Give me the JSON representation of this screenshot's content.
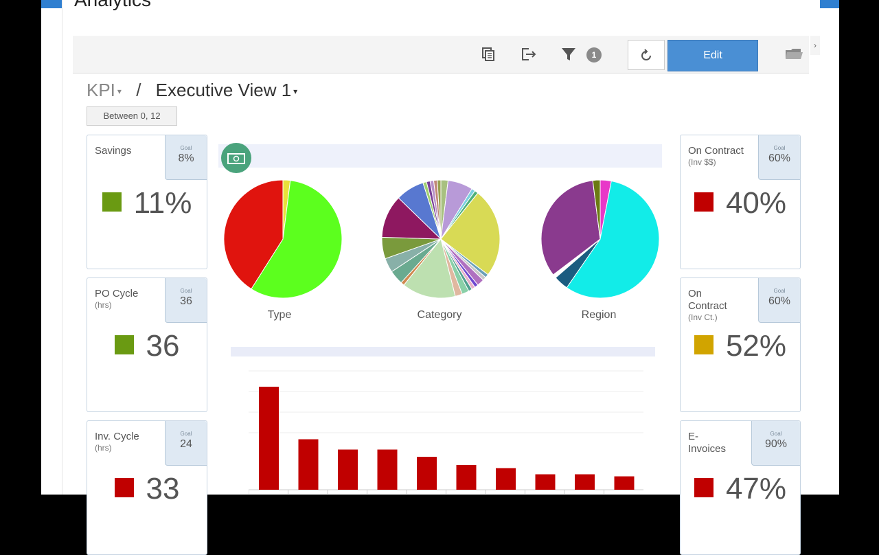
{
  "app": {
    "title": "Analytics"
  },
  "toolbar": {
    "icons": [
      "copy-icon",
      "export-icon",
      "filter-icon",
      "refresh-icon",
      "folder-icon"
    ],
    "filter_count": "1",
    "edit_label": "Edit"
  },
  "breadcrumb": {
    "root": "KPI",
    "separator": "/",
    "current": "Executive View 1"
  },
  "filter_chip": "Between 0, 12",
  "kpis_left": [
    {
      "title": "Savings",
      "subtitle": "",
      "goal_label": "Goal",
      "goal": "8%",
      "value": "11%",
      "status_color": "#6a9a12"
    },
    {
      "title": "PO Cycle",
      "subtitle": "(hrs)",
      "goal_label": "Goal",
      "goal": "36",
      "value": "36",
      "status_color": "#6a9a12"
    },
    {
      "title": "Inv. Cycle",
      "subtitle": "(hrs)",
      "goal_label": "Goal",
      "goal": "24",
      "value": "33",
      "status_color": "#c00000"
    }
  ],
  "kpis_right": [
    {
      "title": "On Contract",
      "subtitle": "(Inv $$)",
      "goal_label": "Goal",
      "goal": "60%",
      "value": "40%",
      "status_color": "#c00000"
    },
    {
      "title": "On Contract",
      "subtitle": "(Inv Ct.)",
      "goal_label": "Goal",
      "goal": "60%",
      "value": "52%",
      "status_color": "#d1a400"
    },
    {
      "title": "E-Invoices",
      "subtitle": "",
      "goal_label": "Goal",
      "goal": "90%",
      "value": "47%",
      "status_color": "#c00000"
    }
  ],
  "chart_data": [
    {
      "type": "pie",
      "title": "Type",
      "slices": [
        {
          "value": 2,
          "color": "#e8e03a"
        },
        {
          "value": 57,
          "color": "#5cff1e"
        },
        {
          "value": 41,
          "color": "#e0140e"
        }
      ]
    },
    {
      "type": "pie",
      "title": "Category",
      "slices": [
        {
          "value": 2,
          "color": "#a8c080"
        },
        {
          "value": 7,
          "color": "#b89ad8"
        },
        {
          "value": 1,
          "color": "#7bd0e0"
        },
        {
          "value": 1,
          "color": "#4eb07a"
        },
        {
          "value": 25,
          "color": "#d8da55"
        },
        {
          "value": 1,
          "color": "#6aa0b8"
        },
        {
          "value": 1,
          "color": "#c8c8c8"
        },
        {
          "value": 2,
          "color": "#b070c0"
        },
        {
          "value": 1,
          "color": "#7048d0"
        },
        {
          "value": 1,
          "color": "#e8b0c8"
        },
        {
          "value": 1,
          "color": "#50a090"
        },
        {
          "value": 2,
          "color": "#8ad0a8"
        },
        {
          "value": 2,
          "color": "#e0b8a0"
        },
        {
          "value": 15,
          "color": "#bde0b0"
        },
        {
          "value": 1,
          "color": "#d08a50"
        },
        {
          "value": 4,
          "color": "#6aaa90"
        },
        {
          "value": 4,
          "color": "#88b0a8"
        },
        {
          "value": 6,
          "color": "#7a9a3c"
        },
        {
          "value": 12,
          "color": "#8e1860"
        },
        {
          "value": 8,
          "color": "#5878d0"
        },
        {
          "value": 1,
          "color": "#a0d070"
        },
        {
          "value": 1,
          "color": "#7a4098"
        },
        {
          "value": 1,
          "color": "#b890c8"
        },
        {
          "value": 1,
          "color": "#c08878"
        },
        {
          "value": 1,
          "color": "#98a050"
        }
      ]
    },
    {
      "type": "pie",
      "title": "Region",
      "slices": [
        {
          "value": 3,
          "color": "#e838c8"
        },
        {
          "value": 56,
          "color": "#12ece8"
        },
        {
          "value": 4,
          "color": "#1b5c80"
        },
        {
          "value": 1,
          "color": "#ffffff"
        },
        {
          "value": 33,
          "color": "#8a3a8e"
        },
        {
          "value": 2,
          "color": "#6b7a12"
        }
      ]
    },
    {
      "type": "bar",
      "title": "",
      "categories": [
        "",
        "",
        "",
        "",
        "",
        "",
        "",
        "",
        "",
        ""
      ],
      "values": [
        100,
        49,
        39,
        39,
        32,
        24,
        21,
        15,
        15,
        13
      ],
      "color": "#c00000"
    }
  ]
}
